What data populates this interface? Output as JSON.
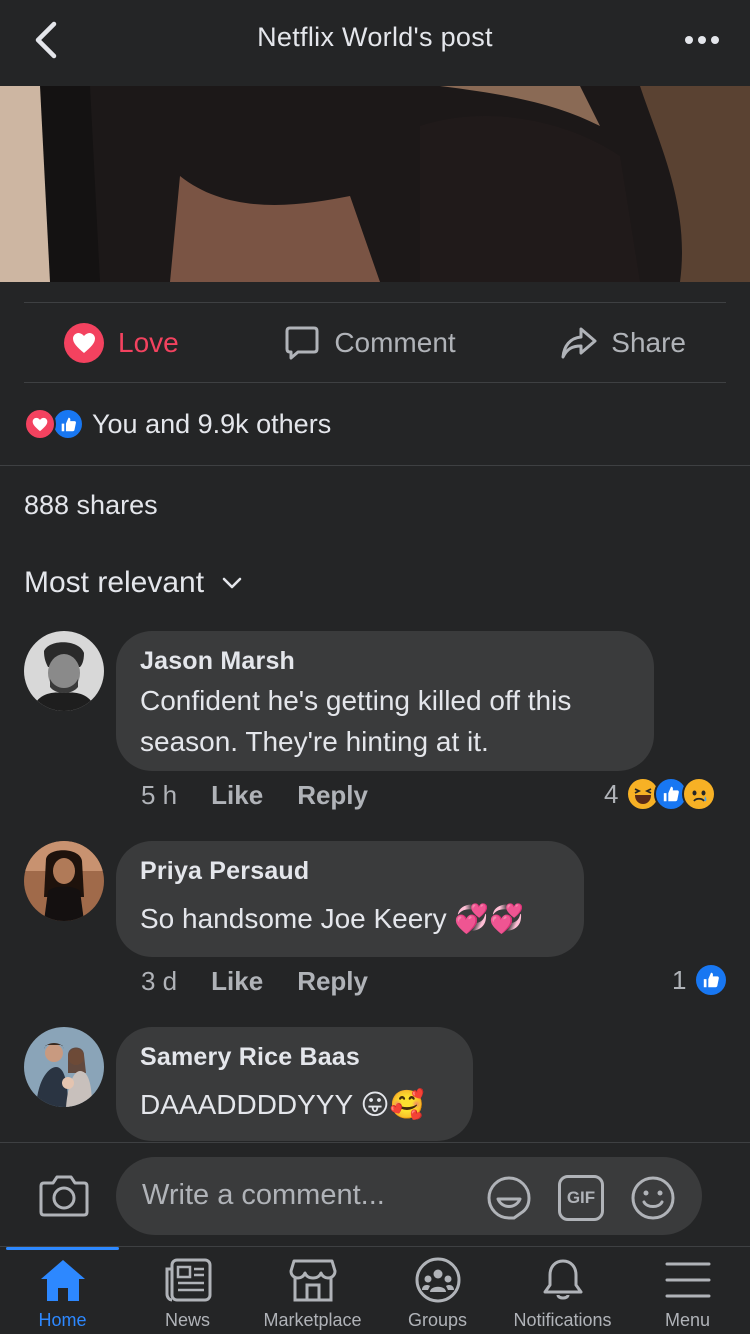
{
  "header": {
    "title": "Netflix World's post"
  },
  "actions": {
    "love": "Love",
    "comment": "Comment",
    "share": "Share"
  },
  "reactions": {
    "summary": "You and 9.9k others"
  },
  "shares": "888 shares",
  "sort": {
    "label": "Most relevant"
  },
  "comments": [
    {
      "name": "Jason Marsh",
      "text_line1": "Confident he's getting killed off this",
      "text_line2": "season. They're hinting at it.",
      "time": "5 h",
      "like": "Like",
      "reply": "Reply",
      "reaction_count": "4"
    },
    {
      "name": "Priya Persaud",
      "text": "So handsome Joe Keery 💞💞",
      "time": "3 d",
      "like": "Like",
      "reply": "Reply",
      "reaction_count": "1"
    },
    {
      "name": "Samery Rice Baas",
      "text": "DAAADDDDYYY 😛🥰"
    }
  ],
  "composer": {
    "placeholder": "Write a comment...",
    "gif": "GIF"
  },
  "tabs": [
    {
      "label": "Home"
    },
    {
      "label": "News"
    },
    {
      "label": "Marketplace"
    },
    {
      "label": "Groups"
    },
    {
      "label": "Notifications"
    },
    {
      "label": "Menu"
    }
  ],
  "colors": {
    "background": "#242526",
    "bubble": "#3a3b3c",
    "accent": "#2d88ff",
    "love": "#f3425f",
    "like": "#1877f2"
  }
}
